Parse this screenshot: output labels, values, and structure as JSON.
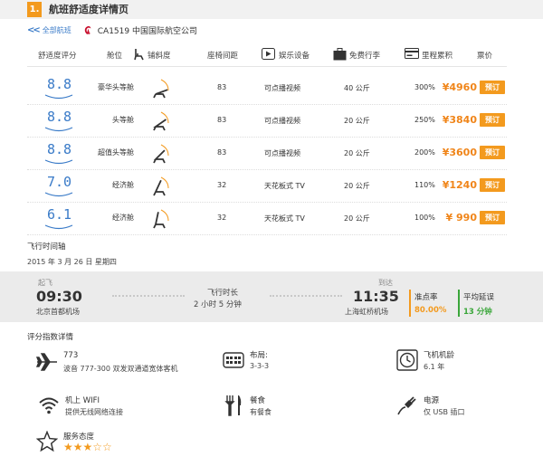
{
  "header": {
    "number": "1.",
    "title": "航班舒适度详情页"
  },
  "nav": {
    "back_label": "全部航班",
    "flight": "CA1519 中国国际航空公司"
  },
  "table": {
    "headers": {
      "score": "舒适度评分",
      "cabin": "舱位",
      "recline": "铺斜度",
      "pitch": "座椅间距",
      "entertainment": "娱乐设备",
      "baggage": "免费行李",
      "mileage": "里程累积",
      "fare": "票价"
    },
    "rows": [
      {
        "score": "8.8",
        "cabin": "豪华头等舱",
        "pitch": "83",
        "entertainment": "可点播视频",
        "baggage": "40 公斤",
        "mileage": "300%",
        "price": "¥4960",
        "book": "预订"
      },
      {
        "score": "8.8",
        "cabin": "头等舱",
        "pitch": "83",
        "entertainment": "可点播视频",
        "baggage": "20 公斤",
        "mileage": "250%",
        "price": "¥3840",
        "book": "预订"
      },
      {
        "score": "8.8",
        "cabin": "超值头等舱",
        "pitch": "83",
        "entertainment": "可点播视频",
        "baggage": "20 公斤",
        "mileage": "200%",
        "price": "¥3600",
        "book": "预订"
      },
      {
        "score": "7.0",
        "cabin": "经济舱",
        "pitch": "32",
        "entertainment": "天花板式 TV",
        "baggage": "20 公斤",
        "mileage": "110%",
        "price": "¥1240",
        "book": "预订"
      },
      {
        "score": "6.1",
        "cabin": "经济舱",
        "pitch": "32",
        "entertainment": "天花板式 TV",
        "baggage": "20 公斤",
        "mileage": "100%",
        "price": "¥ 990",
        "book": "预订"
      }
    ]
  },
  "timeline": {
    "title": "飞行时间轴",
    "date": "2015 年 3 月 26 日  星期四",
    "depart_label": "起飞",
    "depart_time": "09:30",
    "depart_airport": "北京首都机场",
    "duration_label": "飞行时长",
    "duration": "2 小时  5 分钟",
    "arrive_label": "到达",
    "arrive_time": "11:35",
    "arrive_airport": "上海虹桥机场",
    "ontime_label": "准点率",
    "ontime_value": "80.00%",
    "delay_label": "平均延误",
    "delay_value": "13 分钟",
    "colors": {
      "ontime": "#f39a1e",
      "delay": "#3aa63a"
    }
  },
  "details": {
    "title": "评分指数详情",
    "aircraft": {
      "title": "773",
      "sub": "波音 777-300 双发双通道宽体客机"
    },
    "layout": {
      "title": "布局:",
      "sub": "3-3-3"
    },
    "age": {
      "title": "飞机机龄",
      "sub": "6.1 年"
    },
    "wifi": {
      "title": "机上 WIFI",
      "sub": "提供无线网络连接"
    },
    "meal": {
      "title": "餐食",
      "sub": "有餐食"
    },
    "power": {
      "title": "电源",
      "sub": "仅 USB 插口"
    },
    "service": {
      "title": "服务态度",
      "stars_filled": "★★★",
      "stars_empty": "☆☆",
      "rating": 3,
      "max": 5
    }
  },
  "colors": {
    "accent": "#f39a1e",
    "link": "#3a7bc8",
    "score": "#3a7bc8",
    "price": "#f08519"
  }
}
